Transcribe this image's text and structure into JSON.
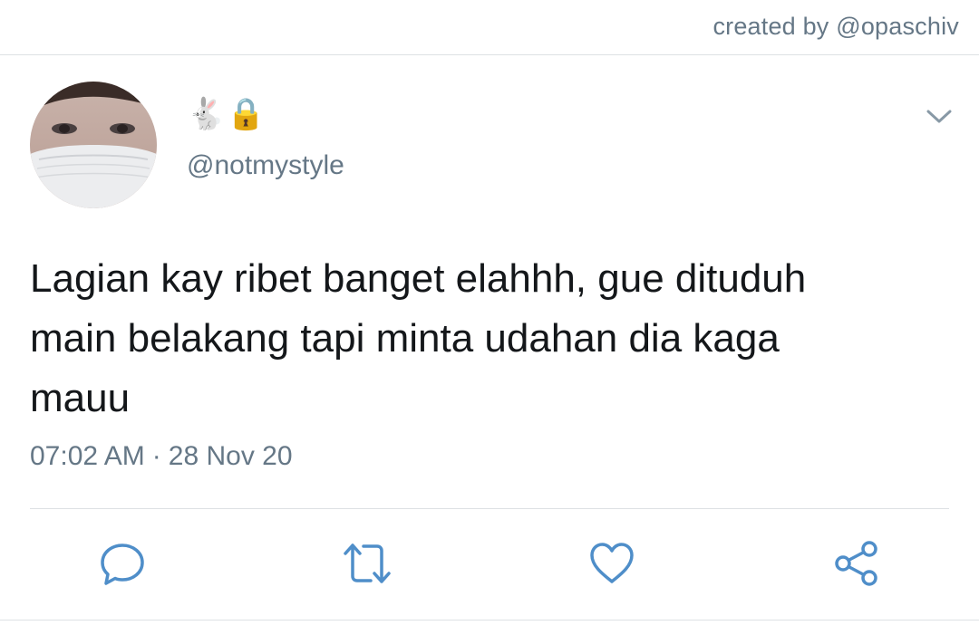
{
  "credit": "created by @opaschiv",
  "tweet": {
    "display_name_emojis": [
      "🐇",
      "🔒"
    ],
    "handle": "@notmystyle",
    "text": "Lagian kay ribet banget elahhh, gue dituduh\nmain belakang tapi minta udahan dia kaga\nmauu",
    "time": "07:02 AM",
    "separator": "·",
    "date": "28 Nov 20"
  },
  "actions": [
    {
      "name": "reply",
      "icon": "reply-icon"
    },
    {
      "name": "retweet",
      "icon": "retweet-icon"
    },
    {
      "name": "like",
      "icon": "heart-icon"
    },
    {
      "name": "share",
      "icon": "share-icon"
    }
  ],
  "colors": {
    "secondary_text": "#657786",
    "primary_text": "#14171a",
    "icon": "#4f8ec9",
    "divider": "#dde1e4"
  }
}
